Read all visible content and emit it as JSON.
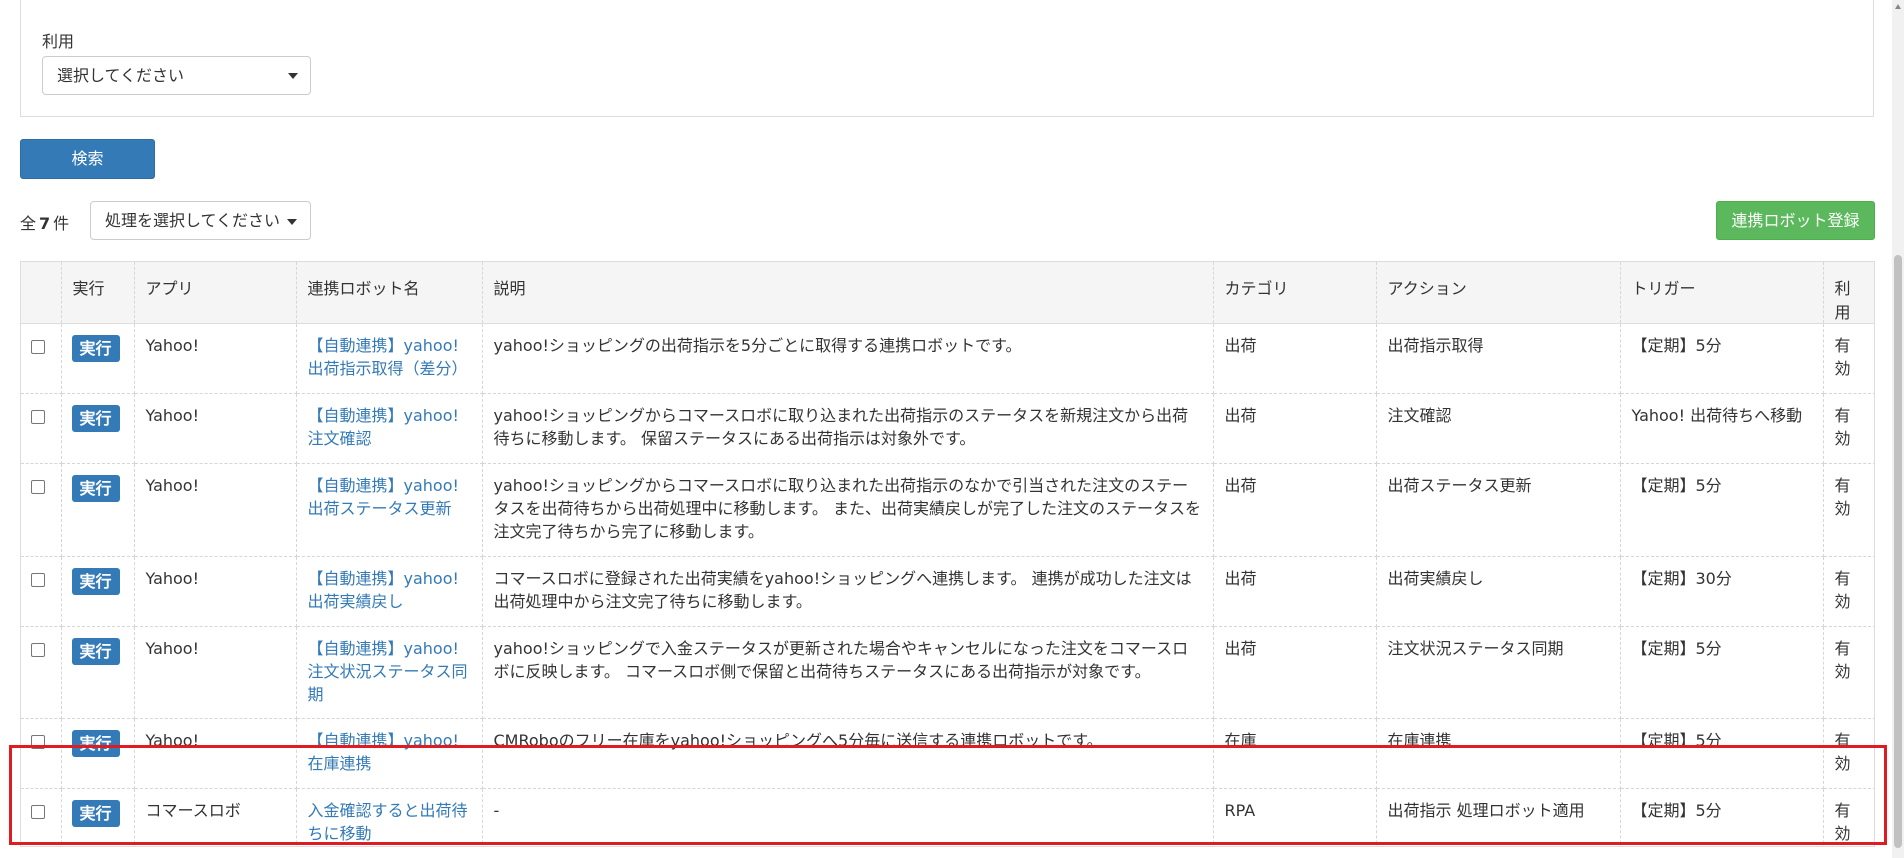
{
  "filter": {
    "usage_label": "利用",
    "usage_select_value": "選択してください"
  },
  "search_button": "検索",
  "result": {
    "prefix": "全",
    "count": "7",
    "suffix": "件",
    "bulk_action_value": "処理を選択してください"
  },
  "register_button": "連携ロボット登録",
  "table": {
    "headers": {
      "run": "実行",
      "app": "アプリ",
      "robot_name": "連携ロボット名",
      "description": "説明",
      "category": "カテゴリ",
      "action": "アクション",
      "trigger": "トリガー",
      "usage": "利用"
    },
    "run_label": "実行",
    "rows": [
      {
        "app": "Yahoo!",
        "robot_name": "【自動連携】yahoo!出荷指示取得（差分）",
        "description": "yahoo!ショッピングの出荷指示を5分ごとに取得する連携ロボットです。",
        "category": "出荷",
        "action": "出荷指示取得",
        "trigger": "【定期】5分",
        "usage": "有効"
      },
      {
        "app": "Yahoo!",
        "robot_name": "【自動連携】yahoo!注文確認",
        "description": "yahoo!ショッピングからコマースロボに取り込まれた出荷指示のステータスを新規注文から出荷待ちに移動します。 保留ステータスにある出荷指示は対象外です。",
        "category": "出荷",
        "action": "注文確認",
        "trigger": "Yahoo! 出荷待ちへ移動",
        "usage": "有効"
      },
      {
        "app": "Yahoo!",
        "robot_name": "【自動連携】yahoo!出荷ステータス更新",
        "description": "yahoo!ショッピングからコマースロボに取り込まれた出荷指示のなかで引当された注文のステータスを出荷待ちから出荷処理中に移動します。 また、出荷実績戻しが完了した注文のステータスを注文完了待ちから完了に移動します。",
        "category": "出荷",
        "action": "出荷ステータス更新",
        "trigger": "【定期】5分",
        "usage": "有効"
      },
      {
        "app": "Yahoo!",
        "robot_name": "【自動連携】yahoo!出荷実績戻し",
        "description": "コマースロボに登録された出荷実績をyahoo!ショッピングへ連携します。 連携が成功した注文は出荷処理中から注文完了待ちに移動します。",
        "category": "出荷",
        "action": "出荷実績戻し",
        "trigger": "【定期】30分",
        "usage": "有効"
      },
      {
        "app": "Yahoo!",
        "robot_name": "【自動連携】yahoo!注文状況ステータス同期",
        "description": "yahoo!ショッピングで入金ステータスが更新された場合やキャンセルになった注文をコマースロボに反映します。 コマースロボ側で保留と出荷待ちステータスにある出荷指示が対象です。",
        "category": "出荷",
        "action": "注文状況ステータス同期",
        "trigger": "【定期】5分",
        "usage": "有効"
      },
      {
        "app": "Yahoo!",
        "robot_name": "【自動連携】yahoo!在庫連携",
        "description": "CMRoboのフリー在庫をyahoo!ショッピングへ5分毎に送信する連携ロボットです。",
        "category": "在庫",
        "action": "在庫連携",
        "trigger": "【定期】5分",
        "usage": "有効"
      },
      {
        "app": "コマースロボ",
        "robot_name": "入金確認すると出荷待ちに移動",
        "description": "-",
        "category": "RPA",
        "action": "出荷指示 処理ロボット適用",
        "trigger": "【定期】5分",
        "usage": "有効"
      }
    ]
  },
  "colors": {
    "primary": "#337ab7",
    "success": "#5cb85c",
    "highlight": "#e11b22"
  }
}
